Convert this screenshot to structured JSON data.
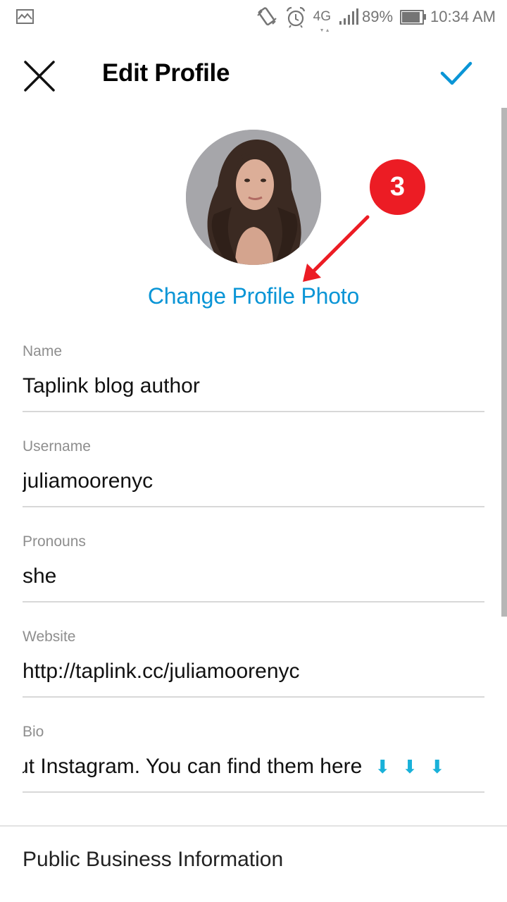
{
  "status_bar": {
    "left_icon": "image-notification-icon",
    "icons": [
      "vibrate-icon",
      "alarm-icon"
    ],
    "network": "4G",
    "signal_icon": "signal-bars-icon",
    "battery_percent": "89%",
    "battery_level": 0.89,
    "time": "10:34 AM"
  },
  "toolbar": {
    "close_icon": "close-icon",
    "title": "Edit Profile",
    "confirm_icon": "checkmark-icon",
    "accent_color": "#0a95d6"
  },
  "profile_photo": {
    "change_label": "Change Profile Photo"
  },
  "annotation": {
    "step_number": "3",
    "color": "#ec1c24"
  },
  "fields": [
    {
      "label": "Name",
      "value": "Taplink blog author"
    },
    {
      "label": "Username",
      "value": "juliamoorenyc"
    },
    {
      "label": "Pronouns",
      "value": "she"
    },
    {
      "label": "Website",
      "value": "http://taplink.cc/juliamoorenyc"
    },
    {
      "label": "Bio",
      "value": "ut Instagram. You can find them here",
      "emoji": [
        "⬇",
        "⬇",
        "⬇"
      ]
    }
  ],
  "sections": {
    "business_info": "Public Business Information"
  }
}
